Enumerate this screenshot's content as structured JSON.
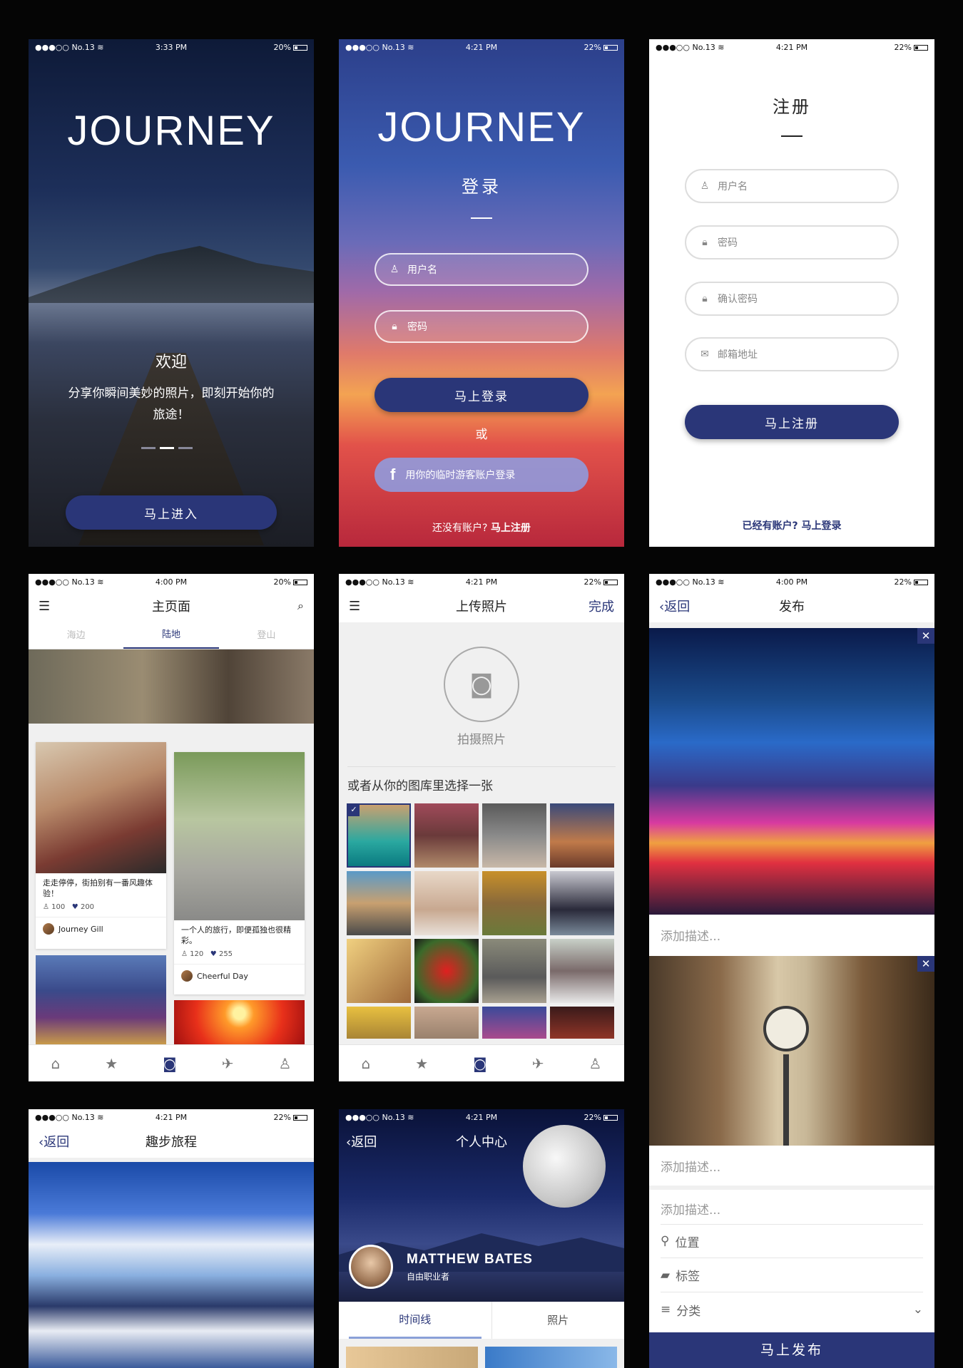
{
  "colors": {
    "accent": "#2a3678",
    "background": "#050505"
  },
  "s1": {
    "status": {
      "carrier": "●●●○○ No.13 ≋",
      "time": "3:33 PM",
      "battery": "20%"
    },
    "logo": "JOURNEY",
    "welcome": "欢迎",
    "tagline": "分享你瞬间美妙的照片，即刻开始你的旅途！",
    "enter": "马上进入"
  },
  "s2": {
    "status": {
      "carrier": "●●●○○ No.13 ≋",
      "time": "4:21 PM",
      "battery": "22%"
    },
    "logo": "JOURNEY",
    "title": "登录",
    "username": "用户名",
    "password": "密码",
    "login": "马上登录",
    "or": "或",
    "fb_icon": "f",
    "fb_login": "用你的临时游客账户登录",
    "no_account": "还没有账户?",
    "register": "马上注册"
  },
  "s3": {
    "status": {
      "carrier": "●●●○○ No.13 ≋",
      "time": "4:21 PM",
      "battery": "22%"
    },
    "title": "注册",
    "username": "用户名",
    "password": "密码",
    "confirm": "确认密码",
    "email": "邮箱地址",
    "submit": "马上注册",
    "have_account": "已经有账户?",
    "login": "马上登录"
  },
  "s4": {
    "status": {
      "carrier": "●●●○○ No.13 ≋",
      "time": "4:00 PM",
      "battery": "20%"
    },
    "title": "主页面",
    "tabs": [
      "海边",
      "陆地",
      "登山"
    ],
    "card1": {
      "caption": "走走停停，街拍别有一番风趣体验！",
      "views": "100",
      "likes": "200",
      "author": "Journey Gill"
    },
    "card2": {
      "caption": "一个人的旅行，即便孤独也很精彩。",
      "views": "120",
      "likes": "255",
      "author": "Cheerful Day"
    }
  },
  "s5": {
    "status": {
      "carrier": "●●●○○ No.13 ≋",
      "time": "4:21 PM",
      "battery": "22%"
    },
    "title": "上传照片",
    "done": "完成",
    "take": "拍摄照片",
    "choose": "或者从你的图库里选择一张"
  },
  "s6": {
    "status": {
      "carrier": "●●●○○ No.13 ≋",
      "time": "4:00 PM",
      "battery": "22%"
    },
    "back": "返回",
    "title": "发布",
    "desc1": "添加描述...",
    "desc2": "添加描述...",
    "desc3": "添加描述...",
    "location": "位置",
    "tags": "标签",
    "category": "分类",
    "publish": "马上发布"
  },
  "s7": {
    "status": {
      "carrier": "●●●○○ No.13 ≋",
      "time": "4:21 PM",
      "battery": "22%"
    },
    "back": "返回",
    "title": "趣步旅程"
  },
  "s8": {
    "status": {
      "carrier": "●●●○○ No.13 ≋",
      "time": "4:21 PM",
      "battery": "22%"
    },
    "back": "返回",
    "title": "个人中心",
    "name": "MATTHEW BATES",
    "role": "自由职业者",
    "tabs": [
      "时间线",
      "照片"
    ]
  },
  "icons": [
    "menu-icon",
    "search-icon",
    "home-icon",
    "star-icon",
    "camera-icon",
    "plane-icon",
    "user-icon",
    "lock-icon",
    "mail-icon",
    "close-icon",
    "pin-icon",
    "tag-icon",
    "list-icon",
    "chevron-down-icon",
    "check-icon"
  ]
}
